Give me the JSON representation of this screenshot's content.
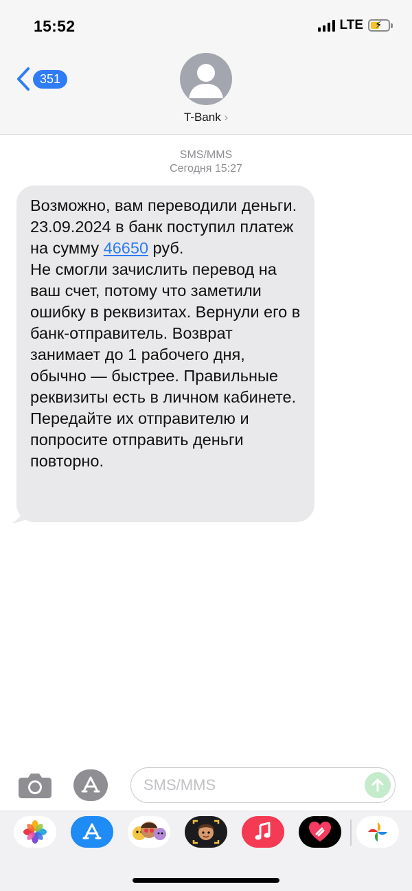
{
  "status_bar": {
    "time": "15:52",
    "network": "LTE"
  },
  "header": {
    "back_badge": "351",
    "contact_name": "T-Bank",
    "contact_chevron": "›"
  },
  "conversation": {
    "channel": "SMS/MMS",
    "timestamp": "Сегодня 15:27",
    "message": {
      "before_link": "Возможно, вам переводили деньги. 23.09.2024  в банк поступил платеж на сумму ",
      "link": "46650",
      "after_link": " руб.\nНе смогли зачислить перевод на ваш счет, потому что заметили ошибку в реквизитах. Вернули его в банк-отправитель. Возврат занимает до 1 рабочего дня, обычно — быстрее. Правильные реквизиты есть в личном кабинете. Передайте их отправителю и попросите отправить деньги повторно."
    }
  },
  "composer": {
    "placeholder": "SMS/MMS"
  },
  "icons": {
    "camera": "camera-icon",
    "apps": "app-store-icon",
    "send": "arrow-up-icon"
  },
  "app_strip": [
    {
      "name": "photos",
      "bg": "#ffffff"
    },
    {
      "name": "app-store",
      "bg": "#1f8bf5"
    },
    {
      "name": "memoji-stickers",
      "bg": "#ffffff"
    },
    {
      "name": "memoji",
      "bg": "#1c1c1e"
    },
    {
      "name": "music",
      "bg": "#f43b53"
    },
    {
      "name": "digital-touch",
      "bg": "#000000"
    },
    {
      "name": "google-photos",
      "bg": "#ffffff"
    }
  ],
  "colors": {
    "accent": "#2f7cf6",
    "bubble": "#e9e9eb",
    "send_disabled": "#c4ebcc"
  }
}
